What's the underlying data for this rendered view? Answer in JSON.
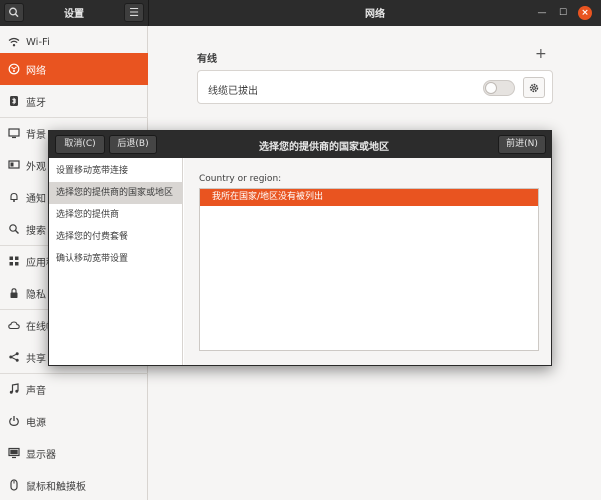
{
  "header": {
    "settings_title": "设置",
    "page_title": "网络",
    "menu_glyph": "☰",
    "min_glyph": "—",
    "max_glyph": "☐",
    "close_glyph": "×"
  },
  "sidebar": {
    "items": [
      {
        "label": "Wi-Fi",
        "icon": "wifi-icon"
      },
      {
        "label": "网络",
        "icon": "network-icon",
        "active": true
      },
      {
        "label": "蓝牙",
        "icon": "bluetooth-icon"
      },
      {
        "label": "背景",
        "icon": "background-icon"
      },
      {
        "label": "外观",
        "icon": "appearance-icon"
      },
      {
        "label": "通知",
        "icon": "bell-icon"
      },
      {
        "label": "搜索",
        "icon": "search-icon"
      },
      {
        "label": "应用程",
        "icon": "apps-icon"
      },
      {
        "label": "隐私",
        "icon": "lock-icon"
      },
      {
        "label": "在线帐",
        "icon": "cloud-icon"
      },
      {
        "label": "共享",
        "icon": "share-icon"
      },
      {
        "label": "声音",
        "icon": "music-icon"
      },
      {
        "label": "电源",
        "icon": "power-icon"
      },
      {
        "label": "显示器",
        "icon": "display-icon"
      },
      {
        "label": "鼠标和触摸板",
        "icon": "mouse-icon"
      }
    ]
  },
  "wired": {
    "title": "有线",
    "add_glyph": "+",
    "status": "线缆已拔出",
    "enabled": false
  },
  "dialog": {
    "cancel_label": "取消(C)",
    "back_label": "后退(B)",
    "forward_label": "前进(N)",
    "title": "选择您的提供商的国家或地区",
    "steps": [
      {
        "label": "设置移动宽带连接"
      },
      {
        "label": "选择您的提供商的国家或地区",
        "active": true
      },
      {
        "label": "选择您的提供商"
      },
      {
        "label": "选择您的付费套餐"
      },
      {
        "label": "确认移动宽带设置"
      }
    ],
    "region_label": "Country or region:",
    "selected_region": "我所在国家/地区没有被列出"
  },
  "colors": {
    "accent": "#e95420",
    "header_bg": "#2c2c2c"
  }
}
